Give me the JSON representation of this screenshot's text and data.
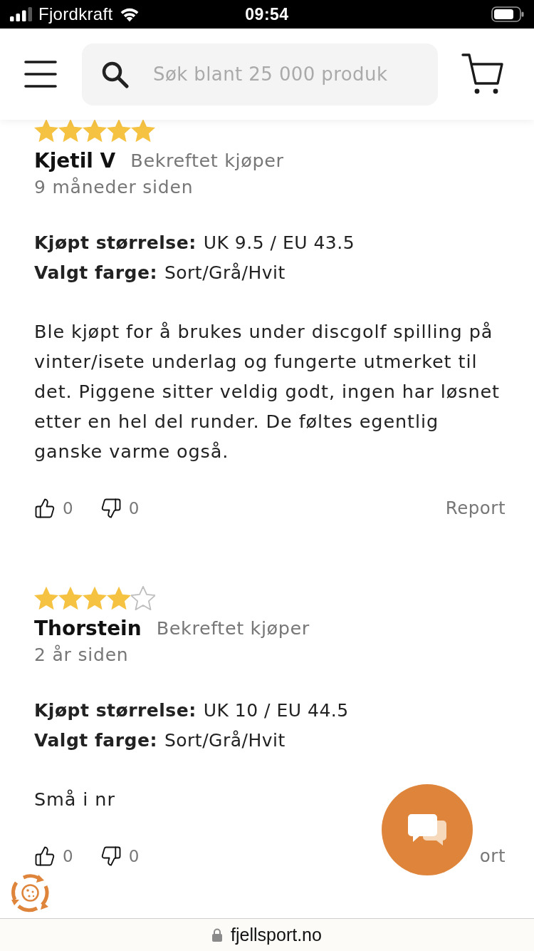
{
  "status_bar": {
    "carrier": "Fjordkraft",
    "time": "09:54"
  },
  "header": {
    "search": {
      "placeholder": "Søk blant 25 000 produk"
    }
  },
  "reviews": [
    {
      "stars": 5,
      "author": "Kjetil V",
      "badge": "Bekreftet kjøper",
      "date": "9 måneder siden",
      "details": [
        {
          "label": "Kjøpt størrelse:",
          "value": "UK 9.5 / EU 43.5"
        },
        {
          "label": "Valgt farge:",
          "value": "Sort/Grå/Hvit"
        }
      ],
      "text": "Ble kjøpt for å brukes under discgolf spilling på vinter/isete underlag og fungerte utmerket til det. Piggene sitter veldig godt, ingen har løsnet etter en hel del runder. De føltes egentlig ganske varme også.",
      "likes": "0",
      "dislikes": "0",
      "report": "Report"
    },
    {
      "stars": 4,
      "author": "Thorstein",
      "badge": "Bekreftet kjøper",
      "date": "2 år siden",
      "details": [
        {
          "label": "Kjøpt størrelse:",
          "value": "UK 10 / EU 44.5"
        },
        {
          "label": "Valgt farge:",
          "value": "Sort/Grå/Hvit"
        }
      ],
      "text": "Små i nr",
      "likes": "0",
      "dislikes": "0",
      "report": "ort"
    }
  ],
  "browser_bar": {
    "url": "fjellsport.no"
  }
}
